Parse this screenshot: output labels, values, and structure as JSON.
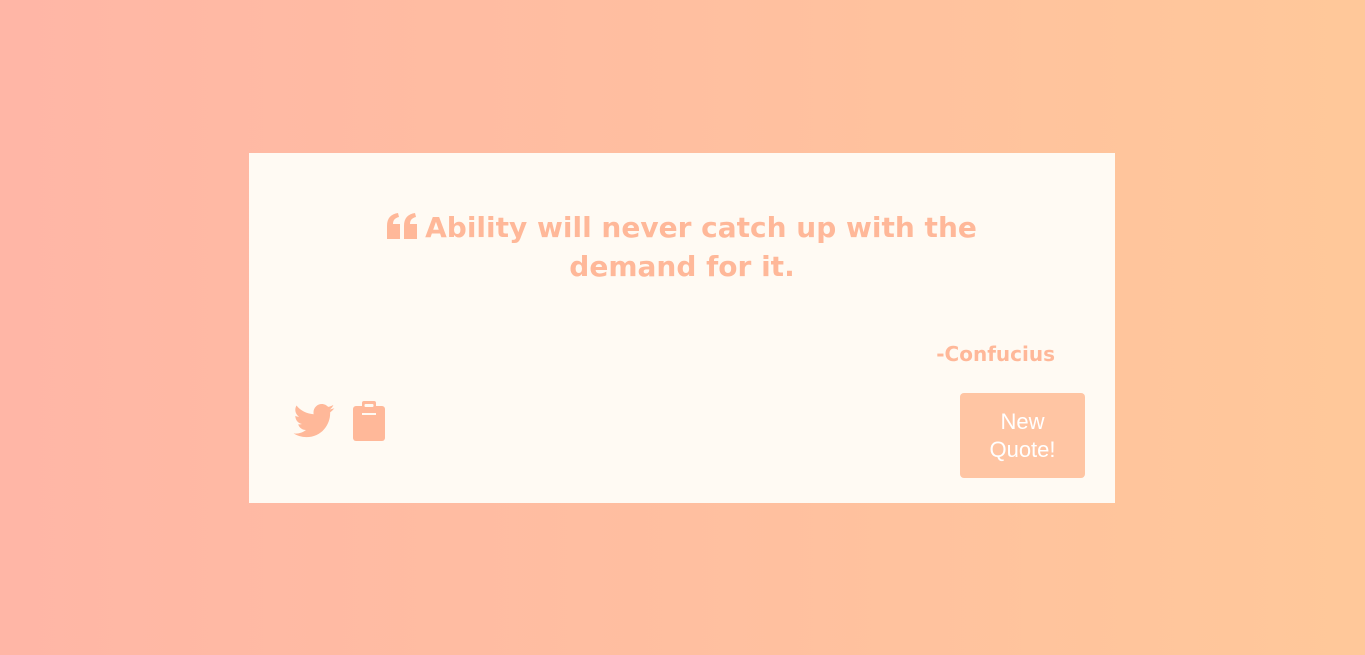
{
  "quote": {
    "text": "Ability will never catch up with the demand for it.",
    "author": "-Confucius"
  },
  "actions": {
    "new_quote_label": "New Quote!"
  },
  "icons": {
    "quote": "quote-left-icon",
    "twitter": "twitter-icon",
    "clipboard": "clipboard-icon"
  },
  "colors": {
    "background_start": "#ffb6a6",
    "background_end": "#ffc89a",
    "card": "#fffaf3",
    "accent": "#ffb899",
    "button": "#ffc5a3",
    "button_text": "#ffffff"
  }
}
